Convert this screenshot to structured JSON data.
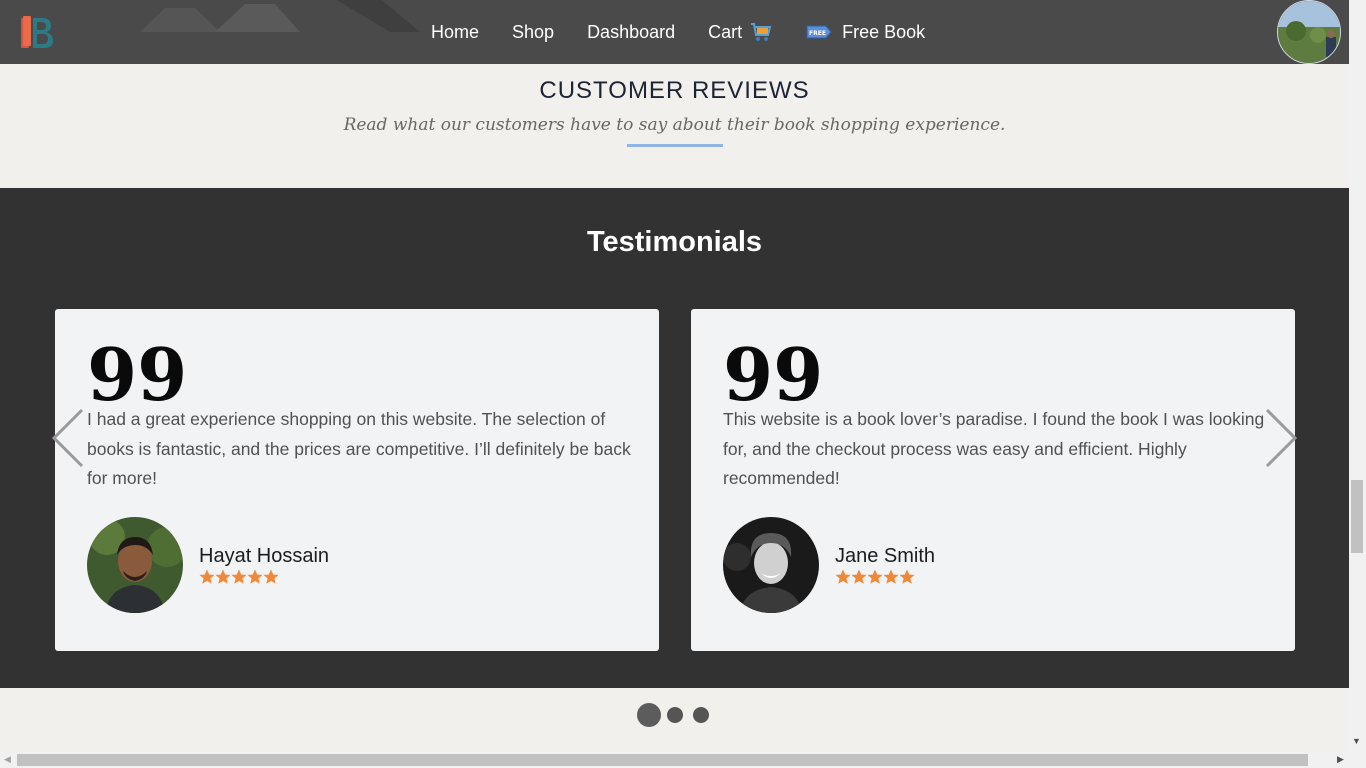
{
  "nav": {
    "items": [
      {
        "label": "Home"
      },
      {
        "label": "Shop"
      },
      {
        "label": "Dashboard"
      },
      {
        "label": "Cart"
      },
      {
        "label": "Free Book"
      }
    ],
    "free_icon_text": "FREE"
  },
  "reviews": {
    "title": "CUSTOMER REVIEWS",
    "subtitle": "Read what our customers have to say about their book shopping experience."
  },
  "testimonials": {
    "title": "Testimonials",
    "cards": [
      {
        "quote": "I had a great experience shopping on this website. The selection of books is fantastic, and the prices are competitive. I’ll definitely be back for more!",
        "name": "Hayat Hossain",
        "rating": 5
      },
      {
        "quote": "This website is a book lover’s paradise. I found the book I was looking for, and the checkout process was easy and efficient. Highly recommended!",
        "name": "Jane Smith",
        "rating": 5
      }
    ],
    "quote_glyph": "99",
    "slide_count": 3,
    "active_slide": 1
  },
  "colors": {
    "nav_bg": "#4a4a4a",
    "section_bg": "#333232",
    "star": "#f0883a",
    "accent_underline": "#8fb4e6"
  }
}
